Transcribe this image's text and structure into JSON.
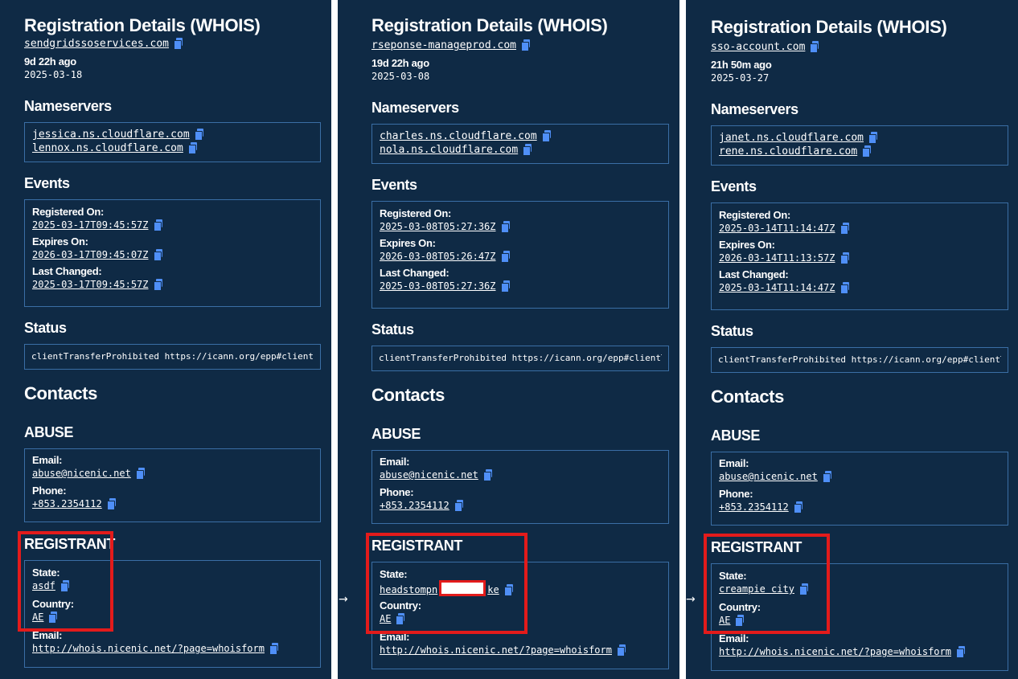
{
  "title": "Registration Details (WHOIS)",
  "labels": {
    "nameservers": "Nameservers",
    "events": "Events",
    "registered_on": "Registered On:",
    "expires_on": "Expires On:",
    "last_changed": "Last Changed:",
    "status": "Status",
    "contacts": "Contacts",
    "abuse": "ABUSE",
    "registrant": "REGISTRANT",
    "email": "Email:",
    "phone": "Phone:",
    "state": "State:",
    "country": "Country:"
  },
  "panels": [
    {
      "domain": "sendgridssoservices.com",
      "ago": "9d 22h ago",
      "date": "2025-03-18",
      "nameservers": [
        "jessica.ns.cloudflare.com",
        "lennox.ns.cloudflare.com"
      ],
      "registered_on": "2025-03-17T09:45:57Z",
      "expires_on": "2026-03-17T09:45:07Z",
      "last_changed": "2025-03-17T09:45:57Z",
      "status": "clientTransferProhibited https://icann.org/epp#clientTransferProhibited",
      "abuse_email": "abuse@nicenic.net",
      "abuse_phone": "+853.2354112",
      "state": "asdf",
      "country": "AE",
      "registrant_email": "http://whois.nicenic.net/?page=whoisform"
    },
    {
      "domain": "rseponse-manageprod.com",
      "ago": "19d 22h ago",
      "date": "2025-03-08",
      "nameservers": [
        "charles.ns.cloudflare.com",
        "nola.ns.cloudflare.com"
      ],
      "registered_on": "2025-03-08T05:27:36Z",
      "expires_on": "2026-03-08T05:26:47Z",
      "last_changed": "2025-03-08T05:27:36Z",
      "status": "clientTransferProhibited https://icann.org/epp#clientTransferProhibited",
      "abuse_email": "abuse@nicenic.net",
      "abuse_phone": "+853.2354112",
      "state_prefix": "headstompn",
      "state_suffix": "ke",
      "country": "AE",
      "registrant_email": "http://whois.nicenic.net/?page=whoisform"
    },
    {
      "domain": "sso-account.com",
      "ago": "21h 50m ago",
      "date": "2025-03-27",
      "nameservers": [
        "janet.ns.cloudflare.com",
        "rene.ns.cloudflare.com"
      ],
      "registered_on": "2025-03-14T11:14:47Z",
      "expires_on": "2026-03-14T11:13:57Z",
      "last_changed": "2025-03-14T11:14:47Z",
      "status": "clientTransferProhibited https://icann.org/epp#clientTransferProhibited",
      "abuse_email": "abuse@nicenic.net",
      "abuse_phone": "+853.2354112",
      "state": "creampie city",
      "country": "AE",
      "registrant_email": "http://whois.nicenic.net/?page=whoisform"
    }
  ],
  "arrow": "→",
  "colors": {
    "panel_bg": "#0f2a45",
    "border": "#3a6ea5",
    "copy_icon": "#4f8ff7",
    "highlight": "#e31b1b"
  }
}
